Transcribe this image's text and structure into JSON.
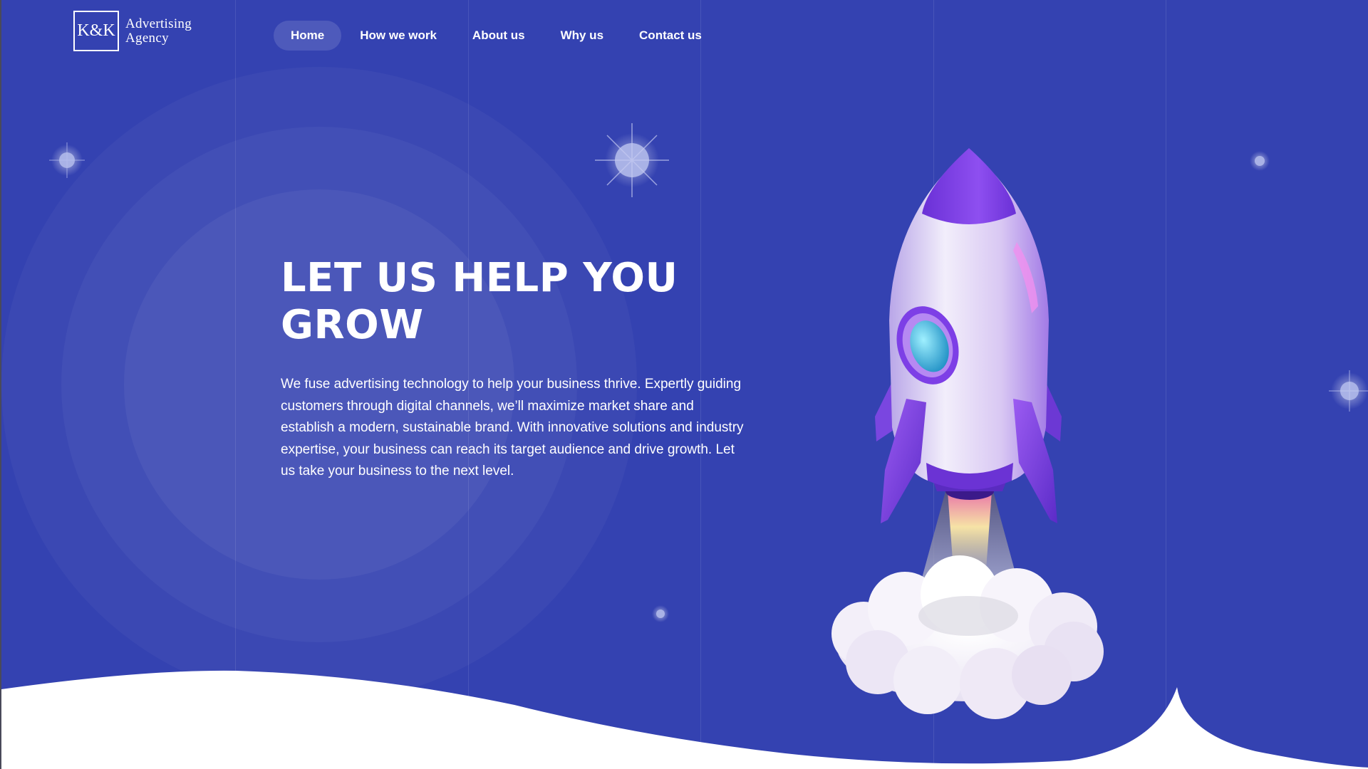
{
  "brand": {
    "logo_mark": "K&K",
    "name_line1": "Advertising",
    "name_line2": "Agency"
  },
  "nav": {
    "items": [
      {
        "label": "Home",
        "active": true
      },
      {
        "label": "How we work",
        "active": false
      },
      {
        "label": "About us",
        "active": false
      },
      {
        "label": "Why us",
        "active": false
      },
      {
        "label": "Contact us",
        "active": false
      }
    ]
  },
  "hero": {
    "title_line1": "LET US HELP YOU",
    "title_line2": "GROW",
    "body": "We fuse advertising technology to help your business thrive. Expertly guiding customers through digital channels, we’ll maximize market share and establish a modern, sustainable brand. With innovative solutions and industry expertise, your business can reach its target audience and drive growth. Let us take your business to the next level."
  },
  "colors": {
    "background": "#3442b1",
    "rocket_purple": "#7b3fe0",
    "rocket_body": "#e4dcf5",
    "window_cyan": "#39b6e3",
    "wave": "#ffffff"
  },
  "icons": [
    "sparkle-star-icon",
    "rocket-illustration",
    "smoke-cloud"
  ]
}
